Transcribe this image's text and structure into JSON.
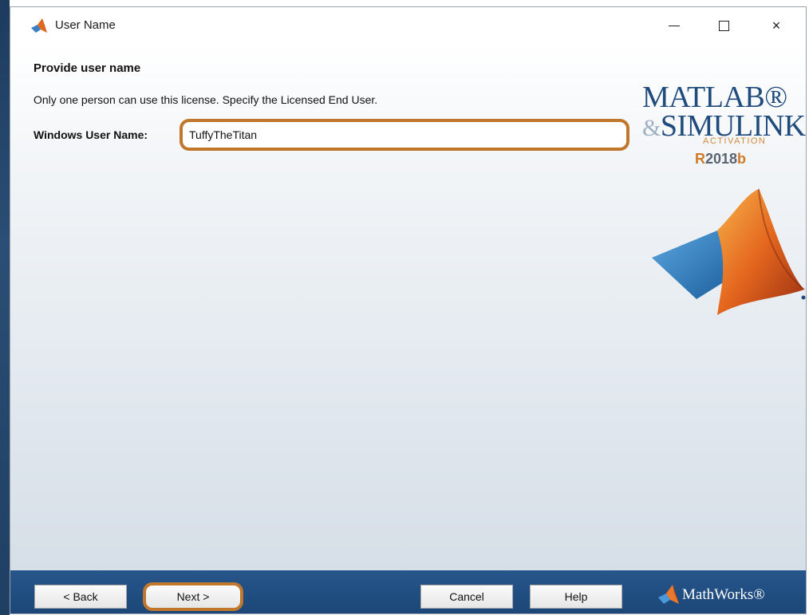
{
  "window": {
    "title": "User Name",
    "controls": {
      "minimize": "—",
      "maximize": "",
      "close": "×"
    }
  },
  "page": {
    "heading": "Provide user name",
    "description": "Only one person can use this license. Specify the Licensed End User.",
    "field_label": "Windows User Name:",
    "user_name_value": "TuffyTheTitan"
  },
  "branding": {
    "line1": "MATLAB®",
    "line2_amp": "&",
    "line2": "SIMULINK®",
    "activation": "ACTIVATION",
    "release_r": "R",
    "release_year": "2018",
    "release_b": "b"
  },
  "footer": {
    "back_label": "< Back",
    "next_label": "Next >",
    "cancel_label": "Cancel",
    "help_label": "Help",
    "company": "MathWorks®"
  },
  "colors": {
    "highlight": "#c0762b",
    "footer_blue": "#1f4b7d",
    "brand_blue": "#1f4b7d",
    "brand_orange": "#d07a2a"
  },
  "icons": {
    "title": "matlab-logo-icon",
    "footer": "mathworks-logo-icon",
    "brand": "matlab-membrane-logo"
  }
}
